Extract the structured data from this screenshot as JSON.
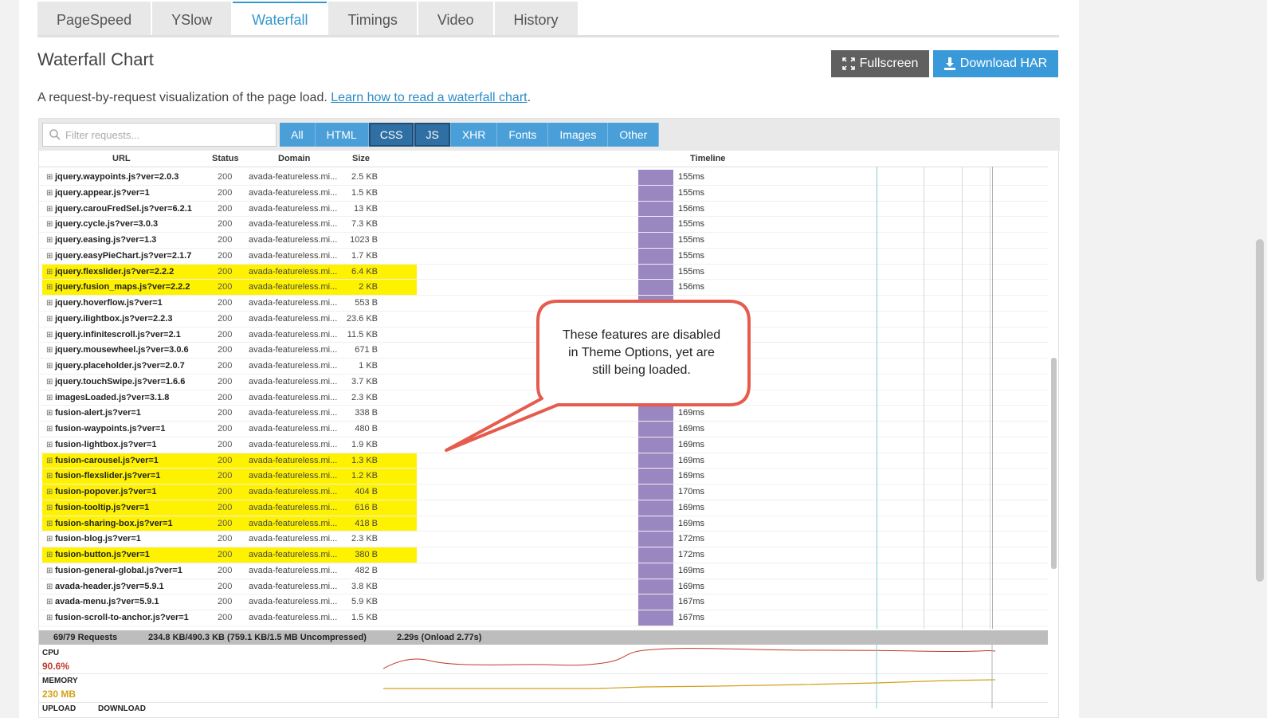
{
  "tabs": [
    "PageSpeed",
    "YSlow",
    "Waterfall",
    "Timings",
    "Video",
    "History"
  ],
  "active_tab": "Waterfall",
  "title": "Waterfall Chart",
  "buttons": {
    "fullscreen": "Fullscreen",
    "download": "Download HAR"
  },
  "description": {
    "text": "A request-by-request visualization of the page load. ",
    "link": "Learn how to read a waterfall chart",
    "end": "."
  },
  "filter": {
    "placeholder": "Filter requests..."
  },
  "filter_tabs": [
    "All",
    "HTML",
    "CSS",
    "JS",
    "XHR",
    "Fonts",
    "Images",
    "Other"
  ],
  "active_filter_tabs": [
    "CSS",
    "JS"
  ],
  "columns": {
    "url": "URL",
    "status": "Status",
    "domain": "Domain",
    "size": "Size",
    "timeline": "Timeline"
  },
  "rows": [
    {
      "url": "jquery.waypoints.js?ver=2.0.3",
      "status": "200",
      "domain": "avada-featureless.mi...",
      "size": "2.5 KB",
      "time": "155ms",
      "highlight": false
    },
    {
      "url": "jquery.appear.js?ver=1",
      "status": "200",
      "domain": "avada-featureless.mi...",
      "size": "1.5 KB",
      "time": "155ms",
      "highlight": false
    },
    {
      "url": "jquery.carouFredSel.js?ver=6.2.1",
      "status": "200",
      "domain": "avada-featureless.mi...",
      "size": "13 KB",
      "time": "156ms",
      "highlight": false
    },
    {
      "url": "jquery.cycle.js?ver=3.0.3",
      "status": "200",
      "domain": "avada-featureless.mi...",
      "size": "7.3 KB",
      "time": "155ms",
      "highlight": false
    },
    {
      "url": "jquery.easing.js?ver=1.3",
      "status": "200",
      "domain": "avada-featureless.mi...",
      "size": "1023 B",
      "time": "155ms",
      "highlight": false
    },
    {
      "url": "jquery.easyPieChart.js?ver=2.1.7",
      "status": "200",
      "domain": "avada-featureless.mi...",
      "size": "1.7 KB",
      "time": "155ms",
      "highlight": false
    },
    {
      "url": "jquery.flexslider.js?ver=2.2.2",
      "status": "200",
      "domain": "avada-featureless.mi...",
      "size": "6.4 KB",
      "time": "155ms",
      "highlight": true
    },
    {
      "url": "jquery.fusion_maps.js?ver=2.2.2",
      "status": "200",
      "domain": "avada-featureless.mi...",
      "size": "2 KB",
      "time": "156ms",
      "highlight": true
    },
    {
      "url": "jquery.hoverflow.js?ver=1",
      "status": "200",
      "domain": "avada-featureless.mi...",
      "size": "553 B",
      "time": "",
      "highlight": false
    },
    {
      "url": "jquery.ilightbox.js?ver=2.2.3",
      "status": "200",
      "domain": "avada-featureless.mi...",
      "size": "23.6 KB",
      "time": "",
      "highlight": false
    },
    {
      "url": "jquery.infinitescroll.js?ver=2.1",
      "status": "200",
      "domain": "avada-featureless.mi...",
      "size": "11.5 KB",
      "time": "",
      "highlight": false
    },
    {
      "url": "jquery.mousewheel.js?ver=3.0.6",
      "status": "200",
      "domain": "avada-featureless.mi...",
      "size": "671 B",
      "time": "",
      "highlight": false
    },
    {
      "url": "jquery.placeholder.js?ver=2.0.7",
      "status": "200",
      "domain": "avada-featureless.mi...",
      "size": "1 KB",
      "time": "",
      "highlight": false
    },
    {
      "url": "jquery.touchSwipe.js?ver=1.6.6",
      "status": "200",
      "domain": "avada-featureless.mi...",
      "size": "3.7 KB",
      "time": "",
      "highlight": false
    },
    {
      "url": "imagesLoaded.js?ver=3.1.8",
      "status": "200",
      "domain": "avada-featureless.mi...",
      "size": "2.3 KB",
      "time": "",
      "highlight": false
    },
    {
      "url": "fusion-alert.js?ver=1",
      "status": "200",
      "domain": "avada-featureless.mi...",
      "size": "338 B",
      "time": "169ms",
      "highlight": false
    },
    {
      "url": "fusion-waypoints.js?ver=1",
      "status": "200",
      "domain": "avada-featureless.mi...",
      "size": "480 B",
      "time": "169ms",
      "highlight": false
    },
    {
      "url": "fusion-lightbox.js?ver=1",
      "status": "200",
      "domain": "avada-featureless.mi...",
      "size": "1.9 KB",
      "time": "169ms",
      "highlight": false
    },
    {
      "url": "fusion-carousel.js?ver=1",
      "status": "200",
      "domain": "avada-featureless.mi...",
      "size": "1.3 KB",
      "time": "169ms",
      "highlight": true
    },
    {
      "url": "fusion-flexslider.js?ver=1",
      "status": "200",
      "domain": "avada-featureless.mi...",
      "size": "1.2 KB",
      "time": "169ms",
      "highlight": true
    },
    {
      "url": "fusion-popover.js?ver=1",
      "status": "200",
      "domain": "avada-featureless.mi...",
      "size": "404 B",
      "time": "170ms",
      "highlight": true
    },
    {
      "url": "fusion-tooltip.js?ver=1",
      "status": "200",
      "domain": "avada-featureless.mi...",
      "size": "616 B",
      "time": "169ms",
      "highlight": true
    },
    {
      "url": "fusion-sharing-box.js?ver=1",
      "status": "200",
      "domain": "avada-featureless.mi...",
      "size": "418 B",
      "time": "169ms",
      "highlight": true
    },
    {
      "url": "fusion-blog.js?ver=1",
      "status": "200",
      "domain": "avada-featureless.mi...",
      "size": "2.3 KB",
      "time": "172ms",
      "highlight": false
    },
    {
      "url": "fusion-button.js?ver=1",
      "status": "200",
      "domain": "avada-featureless.mi...",
      "size": "380 B",
      "time": "172ms",
      "highlight": true
    },
    {
      "url": "fusion-general-global.js?ver=1",
      "status": "200",
      "domain": "avada-featureless.mi...",
      "size": "482 B",
      "time": "169ms",
      "highlight": false
    },
    {
      "url": "avada-header.js?ver=5.9.1",
      "status": "200",
      "domain": "avada-featureless.mi...",
      "size": "3.8 KB",
      "time": "169ms",
      "highlight": false
    },
    {
      "url": "avada-menu.js?ver=5.9.1",
      "status": "200",
      "domain": "avada-featureless.mi...",
      "size": "5.9 KB",
      "time": "167ms",
      "highlight": false
    },
    {
      "url": "fusion-scroll-to-anchor.js?ver=1",
      "status": "200",
      "domain": "avada-featureless.mi...",
      "size": "1.5 KB",
      "time": "167ms",
      "highlight": false
    }
  ],
  "summary": {
    "requests": "69/79 Requests",
    "size": "234.8 KB/490.3 KB  (759.1 KB/1.5 MB Uncompressed)",
    "time": "2.29s  (Onload 2.77s)"
  },
  "perf": {
    "cpu_label": "CPU",
    "cpu_value": "90.6%",
    "memory_label": "MEMORY",
    "memory_value": "230 MB",
    "upload_label": "UPLOAD",
    "download_label": "DOWNLOAD"
  },
  "callout": {
    "line1": "These features are disabled",
    "line2": "in Theme Options, yet are",
    "line3": "still being loaded."
  },
  "colors": {
    "accent": "#3a9ad9",
    "highlight": "#fff200",
    "bar": "#9a86c0",
    "cpu_line": "#c0392b",
    "memory_line": "#d4a017",
    "callout_border": "#e55c4e"
  }
}
